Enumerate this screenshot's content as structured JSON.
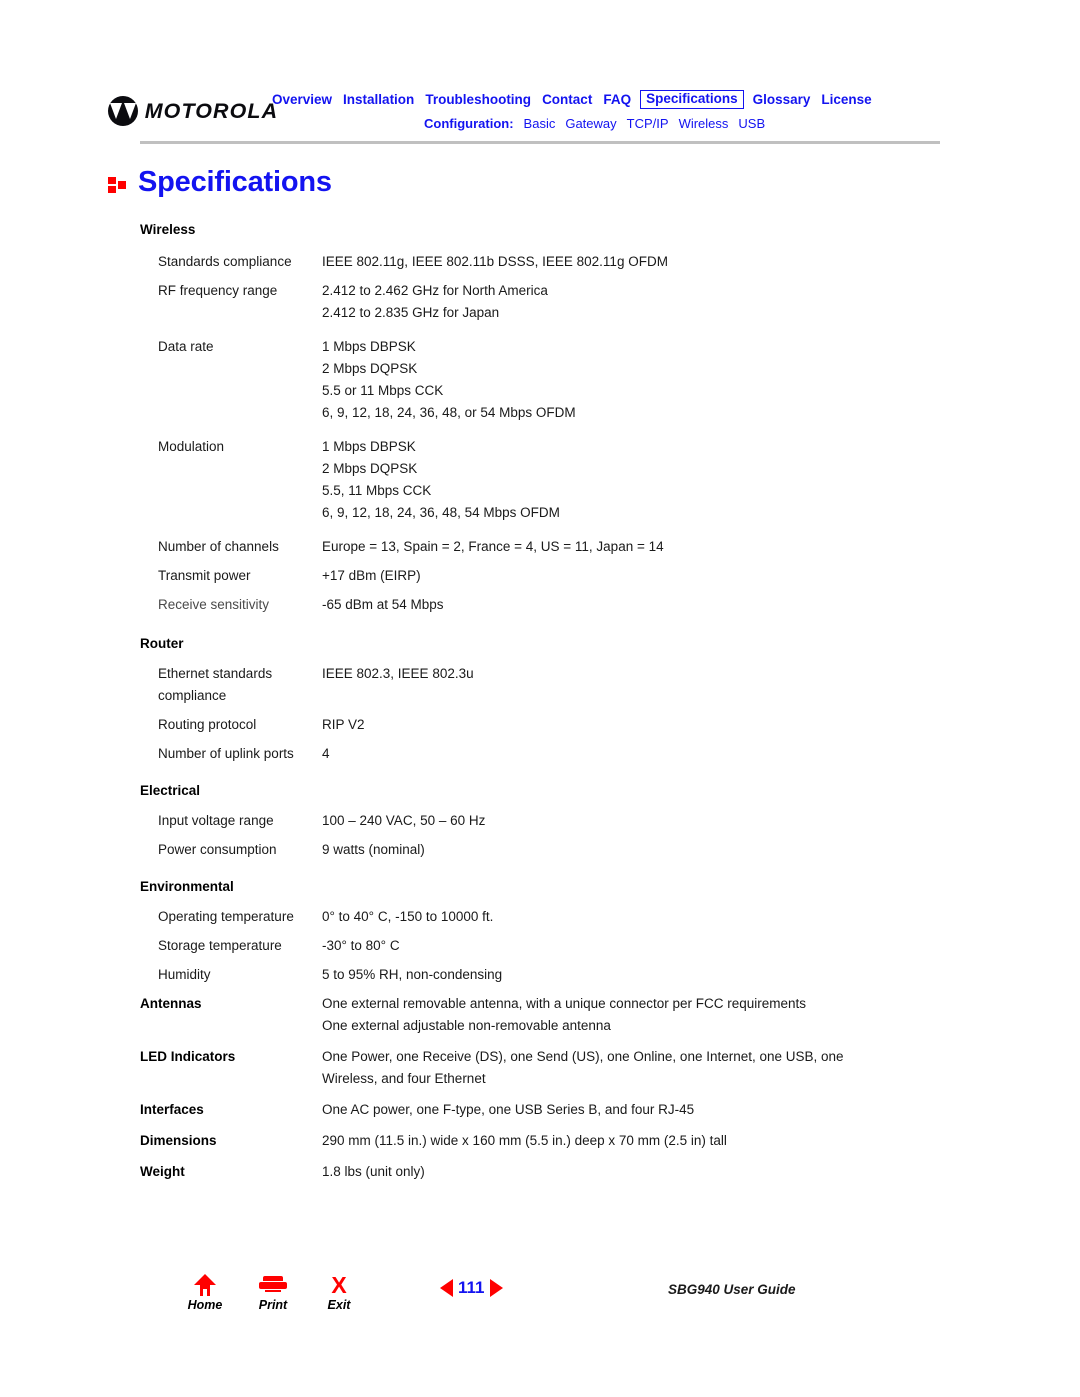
{
  "brand": {
    "name": "MOTOROLA",
    "mark": "motorola-batwing-logo"
  },
  "nav": {
    "primary": [
      {
        "label": "Overview",
        "selected": false
      },
      {
        "label": "Installation",
        "selected": false
      },
      {
        "label": "Troubleshooting",
        "selected": false
      },
      {
        "label": "Contact",
        "selected": false
      },
      {
        "label": "FAQ",
        "selected": false
      },
      {
        "label": "Specifications",
        "selected": true
      },
      {
        "label": "Glossary",
        "selected": false
      },
      {
        "label": "License",
        "selected": false
      }
    ],
    "secondary_label": "Configuration:",
    "secondary": [
      {
        "label": "Basic"
      },
      {
        "label": "Gateway"
      },
      {
        "label": "TCP/IP"
      },
      {
        "label": "Wireless"
      },
      {
        "label": "USB"
      }
    ],
    "accent_color": "#1313f0",
    "rule_color": "#c0c0c0"
  },
  "page": {
    "title": "Specifications",
    "bullet_color": "#ff0000"
  },
  "sections": [
    {
      "heading": "Wireless",
      "rows": [
        {
          "label": "Standards compliance",
          "values": [
            "IEEE 802.11g, IEEE 802.11b DSSS, IEEE 802.11g OFDM"
          ]
        },
        {
          "label": "RF frequency range",
          "values": [
            "2.412 to 2.462 GHz for North America",
            "2.412 to 2.835 GHz for Japan"
          ]
        },
        {
          "label": "Data rate",
          "values": [
            "1 Mbps DBPSK",
            "2 Mbps DQPSK",
            "5.5 or 11 Mbps CCK",
            "6, 9, 12, 18, 24, 36, 48, or 54 Mbps OFDM"
          ]
        },
        {
          "label": "Modulation",
          "values": [
            "1 Mbps DBPSK",
            "2 Mbps DQPSK",
            "5.5, 11 Mbps CCK",
            "6, 9, 12, 18, 24, 36, 48, 54 Mbps OFDM"
          ]
        },
        {
          "label": "Number of channels",
          "values": [
            "Europe = 13, Spain = 2, France = 4, US = 11, Japan = 14"
          ]
        },
        {
          "label": "Transmit power",
          "values": [
            "+17 dBm (EIRP)"
          ]
        },
        {
          "label": "Receive sensitivity",
          "values": [
            "-65 dBm at 54 Mbps"
          ]
        }
      ]
    },
    {
      "heading": "Router",
      "rows": [
        {
          "label": "Ethernet standards compliance",
          "values": [
            "IEEE 802.3, IEEE 802.3u"
          ]
        },
        {
          "label": "Routing protocol",
          "values": [
            "RIP V2"
          ]
        },
        {
          "label": "Number of uplink ports",
          "values": [
            "4"
          ]
        }
      ]
    },
    {
      "heading": "Electrical",
      "rows": [
        {
          "label": "Input voltage range",
          "values": [
            "100 – 240 VAC, 50 – 60 Hz"
          ]
        },
        {
          "label": "Power consumption",
          "values": [
            "9 watts (nominal)"
          ]
        }
      ]
    },
    {
      "heading": "Environmental",
      "rows": [
        {
          "label": "Operating temperature",
          "values": [
            "0° to 40° C, -150 to 10000 ft."
          ]
        },
        {
          "label": "Storage temperature",
          "values": [
            "-30° to 80° C"
          ]
        },
        {
          "label": "Humidity",
          "values": [
            " 5 to 95% RH, non-condensing"
          ]
        }
      ]
    }
  ],
  "flat_rows": [
    {
      "label": "Antennas",
      "values": [
        "One external removable antenna, with a unique connector per FCC requirements",
        "One external adjustable non-removable antenna"
      ]
    },
    {
      "label": "LED Indicators",
      "values": [
        "One Power, one Receive (DS), one Send (US), one Online, one Internet, one USB, one",
        "Wireless, and four Ethernet"
      ]
    },
    {
      "label": "Interfaces",
      "values": [
        "One AC power, one F-type, one USB Series B, and four RJ-45"
      ]
    },
    {
      "label": "Dimensions",
      "values": [
        "290 mm (11.5 in.) wide x 160 mm (5.5 in.) deep x 70 mm (2.5 in) tall"
      ]
    },
    {
      "label": "Weight",
      "values": [
        "1.8 lbs (unit only)"
      ]
    }
  ],
  "footer": {
    "home_label": "Home",
    "print_label": "Print",
    "exit_label": "Exit",
    "exit_glyph": "X",
    "page_number": "111",
    "guide_title": "SBG940 User Guide",
    "icon_color": "#ff0000",
    "page_number_color": "#1313f0"
  }
}
